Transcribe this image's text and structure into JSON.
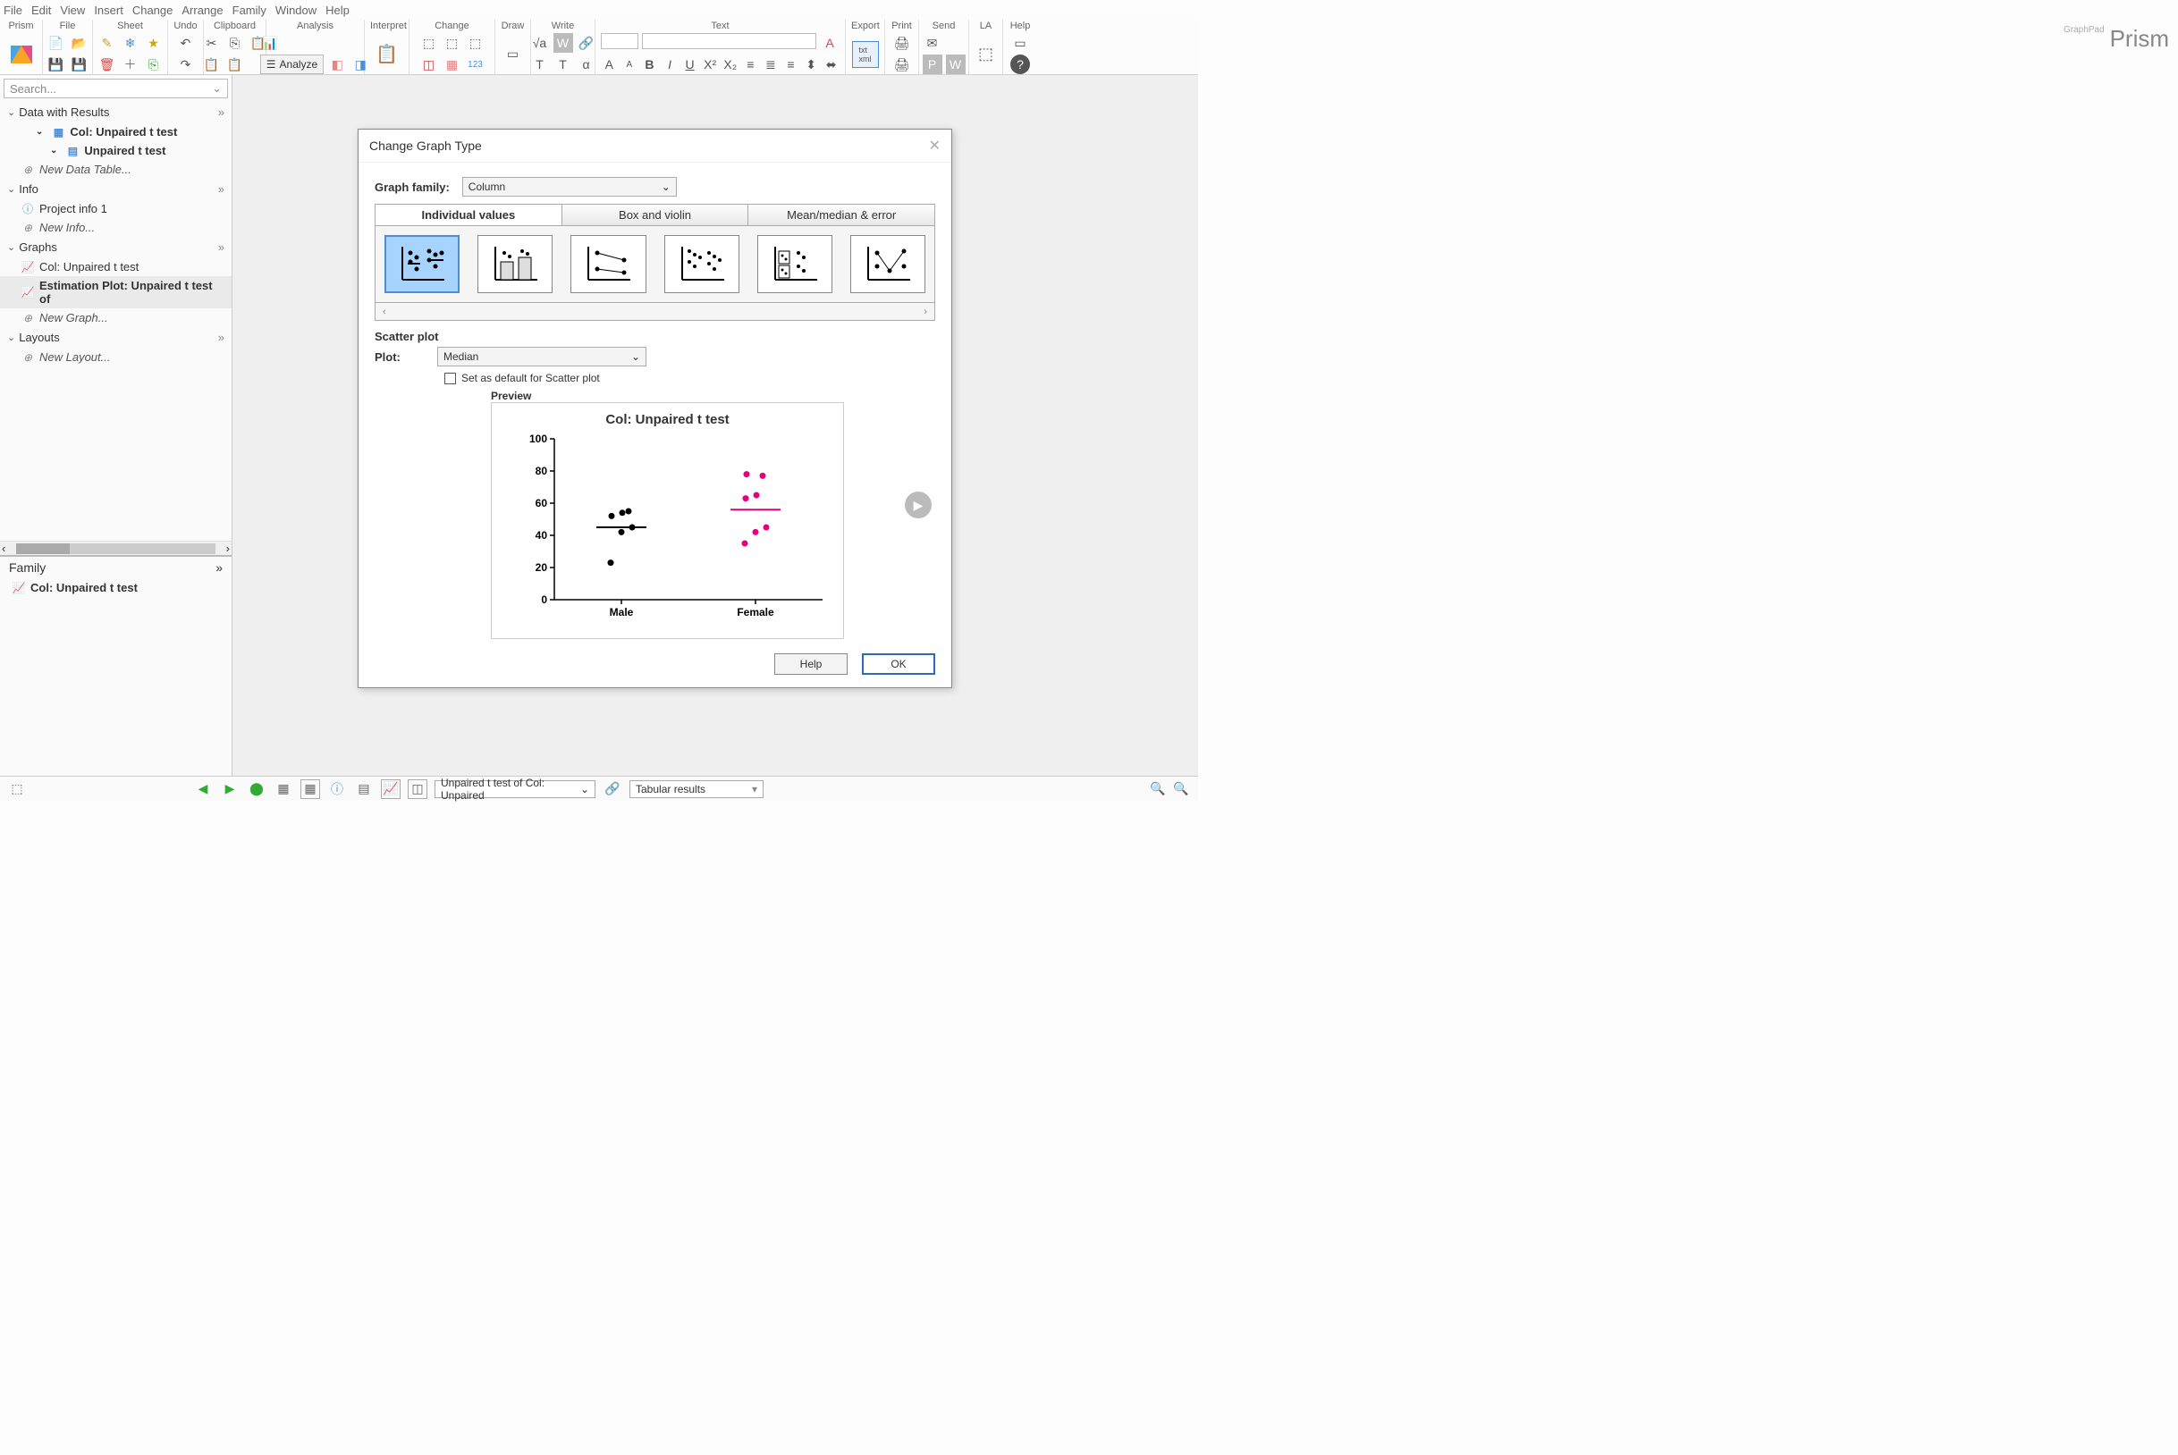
{
  "menu": [
    "File",
    "Edit",
    "View",
    "Insert",
    "Change",
    "Arrange",
    "Family",
    "Window",
    "Help"
  ],
  "ribbon_groups": [
    "Prism",
    "File",
    "Sheet",
    "Undo",
    "Clipboard",
    "Analysis",
    "Interpret",
    "Change",
    "Draw",
    "Write",
    "Text",
    "Export",
    "Print",
    "Send",
    "LA",
    "Help"
  ],
  "analyze_label": "Analyze",
  "logo": "Prism",
  "logo_sup": "GraphPad",
  "search_placeholder": "Search...",
  "sidebar": {
    "sections": [
      {
        "title": "Data with Results",
        "items": [
          {
            "label": "Col: Unpaired t test",
            "bold": true,
            "level": 2,
            "icon": "grid"
          },
          {
            "label": "Unpaired t test",
            "bold": true,
            "level": 3,
            "icon": "sheet"
          },
          {
            "label": "New Data Table...",
            "italic": true,
            "level": 1,
            "icon": "plus"
          }
        ]
      },
      {
        "title": "Info",
        "items": [
          {
            "label": "Project info 1",
            "level": 1,
            "icon": "info"
          },
          {
            "label": "New Info...",
            "italic": true,
            "level": 1,
            "icon": "plus"
          }
        ]
      },
      {
        "title": "Graphs",
        "items": [
          {
            "label": "Col: Unpaired t test",
            "level": 1,
            "icon": "chart"
          },
          {
            "label": "Estimation Plot: Unpaired t test of",
            "bold": true,
            "level": 1,
            "icon": "chart",
            "selected": true
          },
          {
            "label": "New Graph...",
            "italic": true,
            "level": 1,
            "icon": "plus"
          }
        ]
      },
      {
        "title": "Layouts",
        "items": [
          {
            "label": "New Layout...",
            "italic": true,
            "level": 1,
            "icon": "plus"
          }
        ]
      }
    ]
  },
  "family_header": "Family",
  "family_item": "Col: Unpaired t test",
  "dialog": {
    "title": "Change Graph Type",
    "graph_family_label": "Graph family:",
    "graph_family_value": "Column",
    "tabs": [
      "Individual values",
      "Box and violin",
      "Mean/median & error"
    ],
    "active_tab": 0,
    "section_label": "Scatter plot",
    "plot_label": "Plot:",
    "plot_value": "Median",
    "checkbox_label": "Set as default for Scatter plot",
    "preview_label": "Preview",
    "help_btn": "Help",
    "ok_btn": "OK"
  },
  "status": {
    "combo1": "Unpaired t test of Col: Unpaired",
    "combo2": "Tabular results"
  },
  "chart_data": {
    "type": "scatter",
    "title": "Col: Unpaired t test",
    "ylim": [
      0,
      100
    ],
    "yticks": [
      0,
      20,
      40,
      60,
      80,
      100
    ],
    "categories": [
      "Male",
      "Female"
    ],
    "series": [
      {
        "name": "Male",
        "color": "#000000",
        "median": 45,
        "values": [
          23,
          42,
          45,
          52,
          54,
          55
        ]
      },
      {
        "name": "Female",
        "color": "#e6007e",
        "median": 56,
        "values": [
          35,
          42,
          45,
          63,
          65,
          77,
          78
        ]
      }
    ]
  }
}
